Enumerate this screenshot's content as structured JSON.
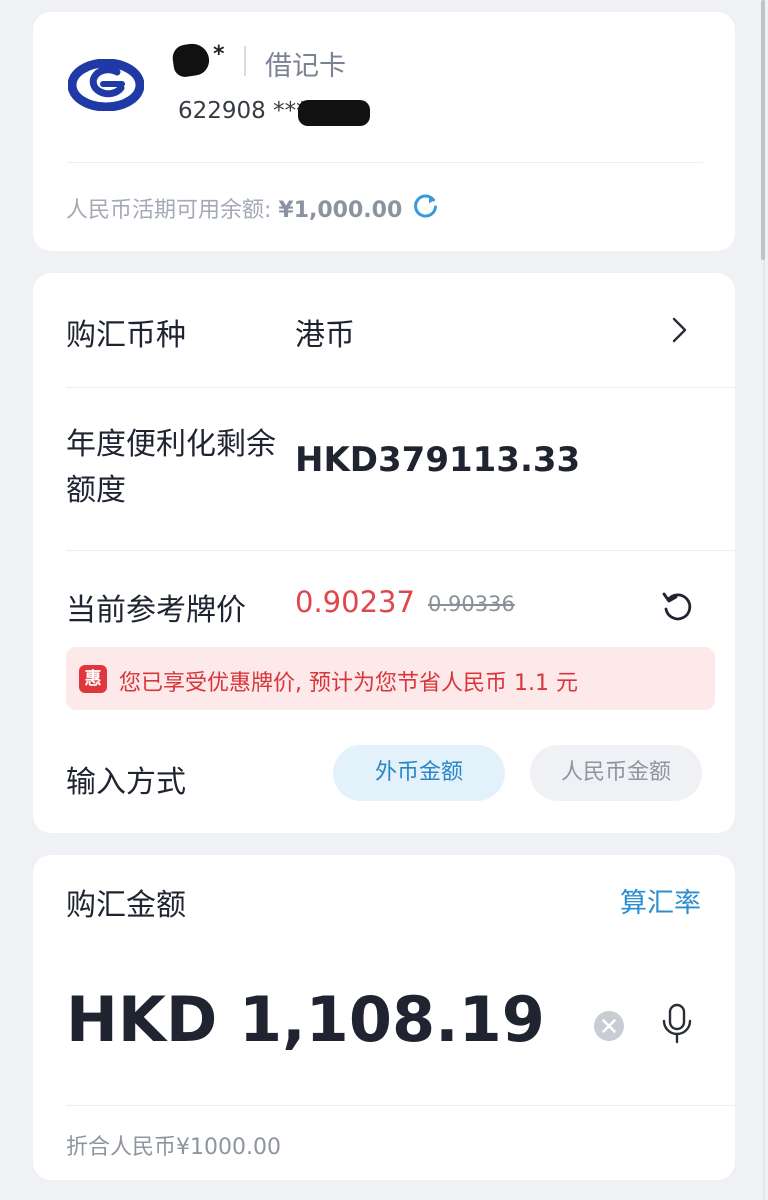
{
  "account": {
    "logo_icon": "bank-logo-icon",
    "name_suffix": "*",
    "card_type": "借记卡",
    "card_number": "622908 ****",
    "balance_label": "人民币活期可用余额: ",
    "balance_value": "¥1,000.00",
    "refresh_icon": "refresh-icon"
  },
  "form": {
    "currency_label": "购汇币种",
    "currency_value": "港币",
    "quota_label": "年度便利化剩余额度",
    "quota_value": "HKD379113.33",
    "rate_label": "当前参考牌价",
    "rate_current": "0.90237",
    "rate_original": "0.90336",
    "discount_badge": "惠",
    "discount_text": "您已享受优惠牌价, 预计为您节省人民币 1.1 元",
    "input_mode_label": "输入方式",
    "input_mode_options": [
      "外币金额",
      "人民币金额"
    ],
    "input_mode_selected": "外币金额"
  },
  "amount": {
    "title": "购汇金额",
    "calc_rate_link": "算汇率",
    "value": "HKD 1,108.19",
    "converted_rmb": "折合人民币¥1000.00"
  },
  "colors": {
    "accent_blue": "#2b8ed1",
    "rate_red": "#e0474c",
    "discount_bg": "#fde9ea",
    "selected_pill_bg": "#e3f1fb"
  }
}
